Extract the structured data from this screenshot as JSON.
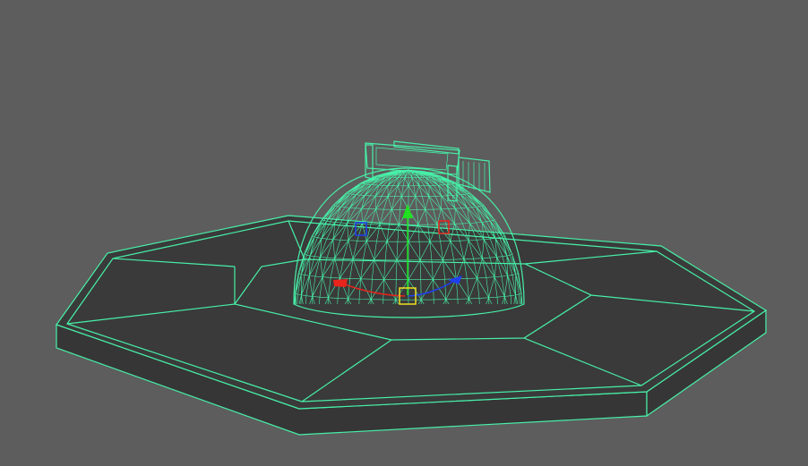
{
  "viewport": {
    "background_color": "#5d5d5d",
    "wireframe_color": "#47f0a8",
    "face_color": "#3a3a3a",
    "view": "perspective"
  },
  "selected_object": {
    "type": "dome",
    "shown_as": "wireframe"
  },
  "base_object": {
    "type": "octagonal platform"
  },
  "manipulator": {
    "type": "rotate",
    "axis_colors": {
      "x": "#e8241c",
      "y": "#20e020",
      "z": "#2040f0",
      "center": "#f0e020"
    }
  }
}
